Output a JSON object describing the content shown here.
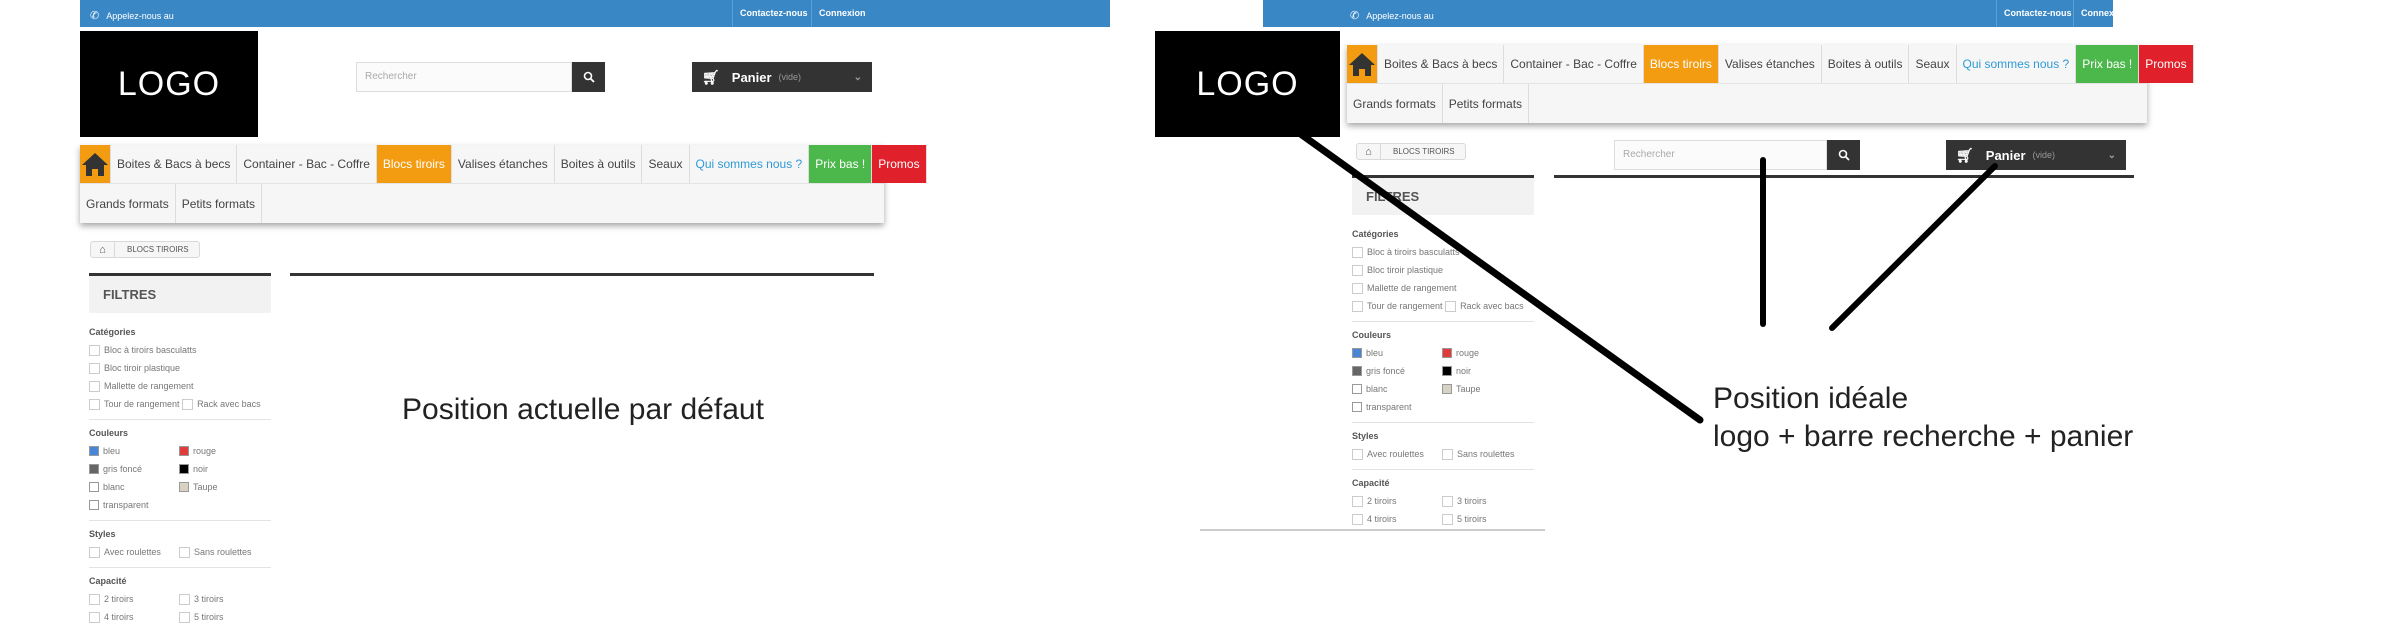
{
  "topbar": {
    "call_label": "Appelez-nous au",
    "contact_label": "Contactez-nous",
    "login_label": "Connexion"
  },
  "logo": {
    "text": "LOGO"
  },
  "search": {
    "placeholder": "Rechercher"
  },
  "cart": {
    "label": "Panier",
    "status": "(vide)"
  },
  "menu": {
    "row1": [
      "Boites & Bacs à becs",
      "Container - Bac - Coffre",
      "Blocs tiroirs",
      "Valises étanches",
      "Boites à outils",
      "Seaux",
      "Qui sommes nous ?",
      "Prix bas !",
      "Promos"
    ],
    "row2": [
      "Grands formats",
      "Petits formats"
    ]
  },
  "breadcrumb": {
    "current": "Blocs tiroirs"
  },
  "filters": {
    "title": "FILTRES",
    "categories_title": "Catégories",
    "categories": [
      "Bloc à tiroirs basculatts",
      "Bloc tiroir plastique",
      "Mallette de rangement",
      "Tour de rangement",
      "Rack avec bacs"
    ],
    "colors_title": "Couleurs",
    "colors": [
      {
        "label": "bleu",
        "color": "#4a86d8"
      },
      {
        "label": "rouge",
        "color": "#e03c3c"
      },
      {
        "label": "gris foncé",
        "color": "#666666"
      },
      {
        "label": "noir",
        "color": "#000000"
      },
      {
        "label": "blanc",
        "color": "#ffffff"
      },
      {
        "label": "Taupe",
        "color": "#d8d2c4"
      },
      {
        "label": "transparent",
        "color": "#ffffff"
      }
    ],
    "styles_title": "Styles",
    "styles": [
      "Avec roulettes",
      "Sans roulettes"
    ],
    "capacity_title": "Capacité",
    "capacity": [
      "2 tiroirs",
      "3 tiroirs",
      "4 tiroirs",
      "5 tiroirs"
    ]
  },
  "captions": {
    "current": "Position actuelle par défaut",
    "ideal_line1": "Position idéale",
    "ideal_line2": "logo + barre recherche + panier"
  },
  "colors": {
    "topbar": "#3a87c5",
    "accent_orange": "#f39c12",
    "accent_green": "#4cb84c",
    "accent_red": "#e0202b",
    "link_blue": "#2f9ad6"
  }
}
